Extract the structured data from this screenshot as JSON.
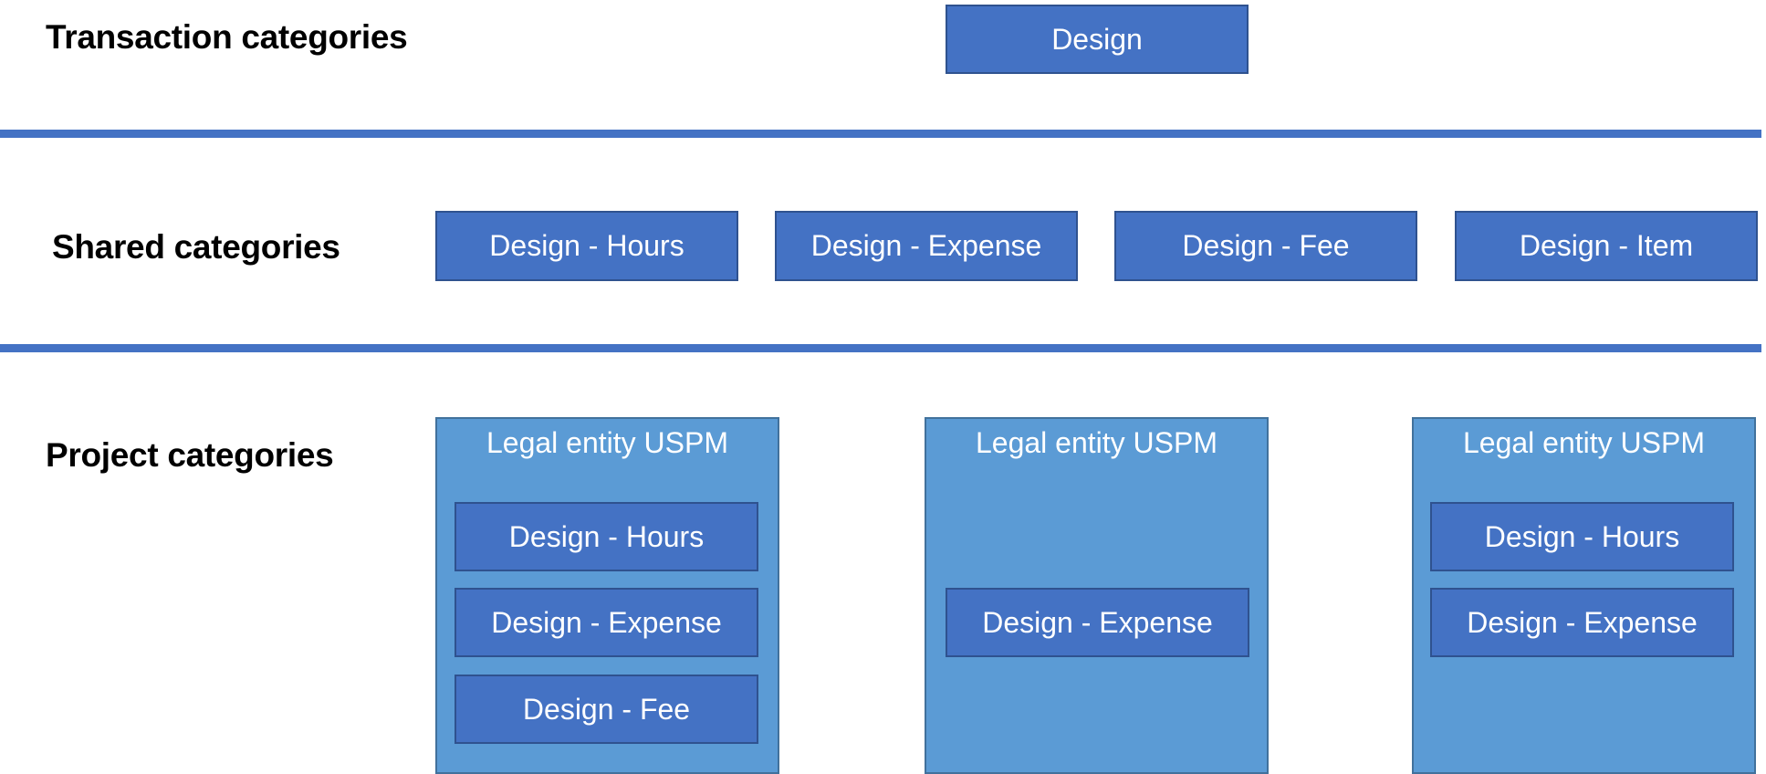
{
  "sections": {
    "transaction": {
      "label": "Transaction categories",
      "boxes": [
        "Design"
      ]
    },
    "shared": {
      "label": "Shared categories",
      "boxes": [
        "Design - Hours",
        "Design - Expense",
        "Design - Fee",
        "Design - Item"
      ]
    },
    "project": {
      "label": "Project categories",
      "containers": [
        {
          "title": "Legal entity USPM",
          "boxes": [
            "Design - Hours",
            "Design - Expense",
            "Design - Fee"
          ]
        },
        {
          "title": "Legal entity USPM",
          "boxes": [
            "Design - Expense"
          ]
        },
        {
          "title": "Legal entity USPM",
          "boxes": [
            "Design - Hours",
            "Design - Expense"
          ]
        }
      ]
    }
  },
  "colors": {
    "box_fill": "#4472C4",
    "box_border": "#2F528F",
    "container_fill": "#5B9BD5",
    "container_border": "#41719C",
    "divider": "#4472C4"
  }
}
